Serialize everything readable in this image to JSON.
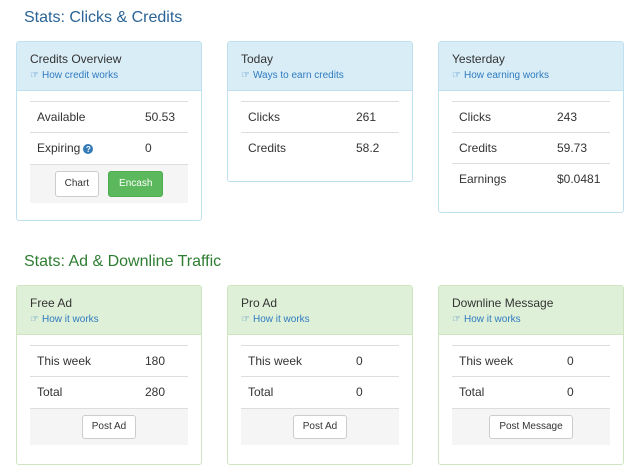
{
  "section1": {
    "title": "Stats: Clicks & Credits"
  },
  "section2": {
    "title": "Stats: Ad & Downline Traffic"
  },
  "credits_overview": {
    "title": "Credits Overview",
    "link": "How credit works",
    "rows": [
      {
        "label": "Available",
        "value": "50.53"
      },
      {
        "label": "Expiring",
        "value": "0"
      }
    ],
    "chart_button": "Chart",
    "encash_button": "Encash"
  },
  "today": {
    "title": "Today",
    "link": "Ways to earn credits",
    "rows": [
      {
        "label": "Clicks",
        "value": "261"
      },
      {
        "label": "Credits",
        "value": "58.2"
      }
    ]
  },
  "yesterday": {
    "title": "Yesterday",
    "link": "How earning works",
    "rows": [
      {
        "label": "Clicks",
        "value": "243"
      },
      {
        "label": "Credits",
        "value": "59.73"
      },
      {
        "label": "Earnings",
        "value": "$0.0481"
      }
    ]
  },
  "free_ad": {
    "title": "Free Ad",
    "link": "How it works",
    "rows": [
      {
        "label": "This week",
        "value": "180"
      },
      {
        "label": "Total",
        "value": "280"
      }
    ],
    "button": "Post Ad"
  },
  "pro_ad": {
    "title": "Pro Ad",
    "link": "How it works",
    "rows": [
      {
        "label": "This week",
        "value": "0"
      },
      {
        "label": "Total",
        "value": "0"
      }
    ],
    "button": "Post Ad"
  },
  "downline": {
    "title": "Downline Message",
    "link": "How it works",
    "rows": [
      {
        "label": "This week",
        "value": "0"
      },
      {
        "label": "Total",
        "value": "0"
      }
    ],
    "button": "Post Message"
  },
  "colors": {
    "blue_header": "#d9edf7",
    "green_header": "#dff0d8",
    "success": "#5cb85c",
    "link": "#2f7bbf"
  },
  "icons": {
    "link_icon": "thumbs-up-icon",
    "help_icon": "question-circle-icon"
  }
}
